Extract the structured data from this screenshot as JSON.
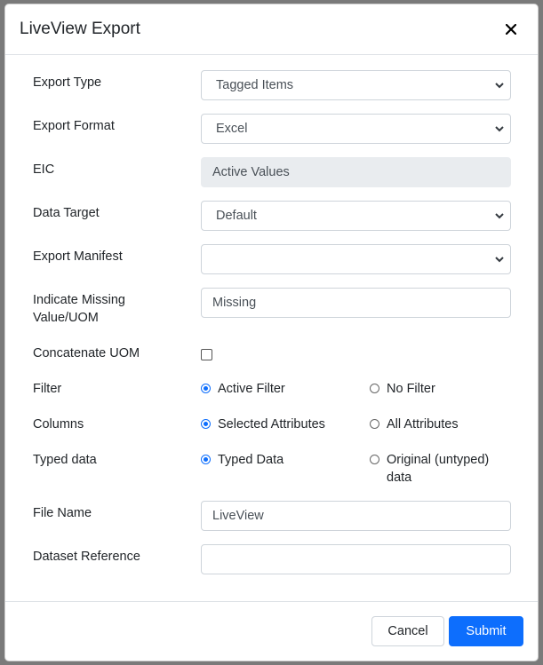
{
  "modal": {
    "title": "LiveView Export",
    "close_icon": "close-icon"
  },
  "form": {
    "export_type": {
      "label": "Export Type",
      "value": "Tagged Items"
    },
    "export_format": {
      "label": "Export Format",
      "value": "Excel"
    },
    "eic": {
      "label": "EIC",
      "value": "Active Values"
    },
    "data_target": {
      "label": "Data Target",
      "value": "Default"
    },
    "export_manifest": {
      "label": "Export Manifest",
      "value": ""
    },
    "missing_value": {
      "label": "Indicate Missing Value/UOM",
      "value": "Missing"
    },
    "concatenate_uom": {
      "label": "Concatenate UOM",
      "checked": false
    },
    "filter": {
      "label": "Filter",
      "options": [
        {
          "label": "Active Filter",
          "selected": true
        },
        {
          "label": "No Filter",
          "selected": false
        }
      ]
    },
    "columns": {
      "label": "Columns",
      "options": [
        {
          "label": "Selected Attributes",
          "selected": true
        },
        {
          "label": "All Attributes",
          "selected": false
        }
      ]
    },
    "typed_data": {
      "label": "Typed data",
      "options": [
        {
          "label": "Typed Data",
          "selected": true
        },
        {
          "label": "Original (untyped) data",
          "selected": false
        }
      ]
    },
    "file_name": {
      "label": "File Name",
      "value": "LiveView"
    },
    "dataset_reference": {
      "label": "Dataset Reference",
      "value": ""
    }
  },
  "footer": {
    "cancel_label": "Cancel",
    "submit_label": "Submit"
  },
  "colors": {
    "accent": "#0d6efd",
    "backdrop": "#7a7a7a",
    "disabled_field": "#e9ecef"
  }
}
